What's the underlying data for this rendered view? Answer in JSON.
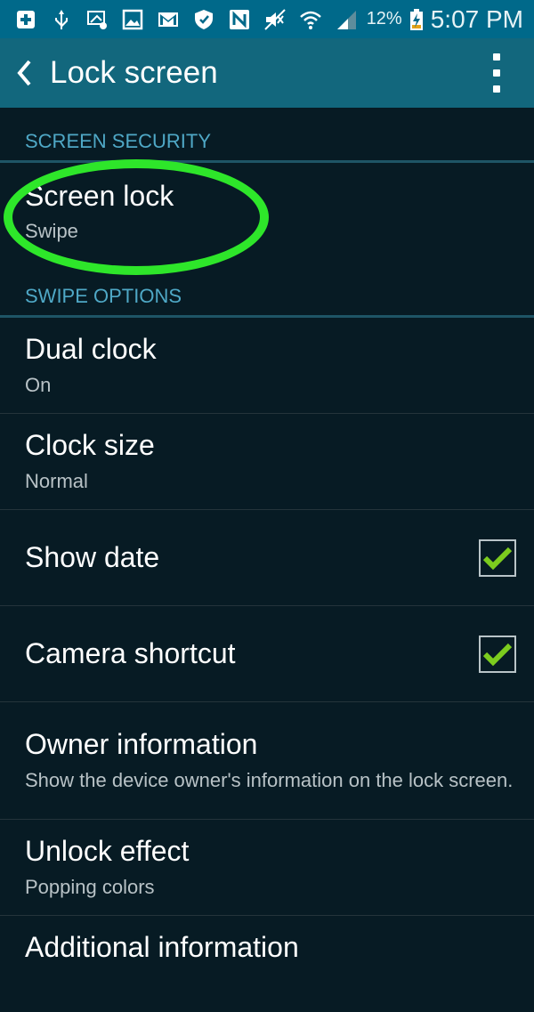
{
  "status_bar": {
    "icons": [
      "plus-box-icon",
      "usb-icon",
      "screen-mirror-icon",
      "image-icon",
      "gmail-icon",
      "shield-icon",
      "nfc-icon",
      "mute-icon",
      "wifi-icon",
      "signal-icon"
    ],
    "battery": "12%",
    "time": "5:07 PM"
  },
  "app_bar": {
    "title": "Lock screen"
  },
  "sections": {
    "screen_security": "SCREEN SECURITY",
    "swipe_options": "SWIPE OPTIONS"
  },
  "items": {
    "screen_lock": {
      "title": "Screen lock",
      "value": "Swipe"
    },
    "dual_clock": {
      "title": "Dual clock",
      "value": "On"
    },
    "clock_size": {
      "title": "Clock size",
      "value": "Normal"
    },
    "show_date": {
      "title": "Show date",
      "checked": true
    },
    "camera_shortcut": {
      "title": "Camera shortcut",
      "checked": true
    },
    "owner_information": {
      "title": "Owner information",
      "value": "Show the device owner's information on the lock screen."
    },
    "unlock_effect": {
      "title": "Unlock effect",
      "value": "Popping colors"
    },
    "additional_information": {
      "title": "Additional information"
    }
  },
  "colors": {
    "status_bar": "#00698a",
    "app_bar": "#12677d",
    "background": "#071b24",
    "section": "#4fa8c6",
    "highlight": "#2ee62a",
    "check": "#7ccc1e"
  }
}
